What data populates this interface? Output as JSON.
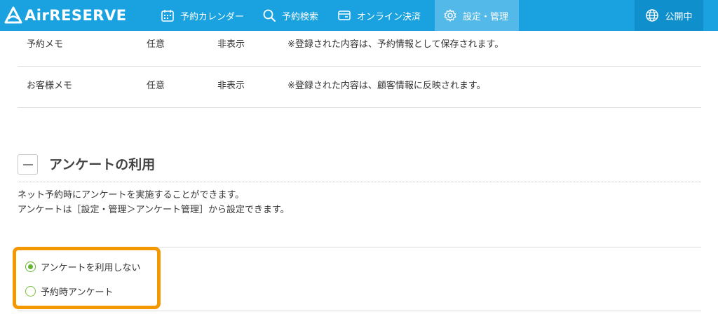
{
  "header": {
    "logo_text": "AirRESERVE",
    "nav": [
      {
        "label": "予約カレンダー",
        "icon": "calendar-icon"
      },
      {
        "label": "予約検索",
        "icon": "search-icon"
      },
      {
        "label": "オンライン決済",
        "icon": "card-icon"
      },
      {
        "label": "設定・管理",
        "icon": "gear-icon",
        "active": true
      }
    ],
    "publish_label": "公開中",
    "colors": {
      "bar": "#1aa2e0",
      "active": "#53b9e8",
      "publish_bg": "#0f8fcc"
    }
  },
  "memo_rows": [
    {
      "name": "予約メモ",
      "required": "任意",
      "display": "非表示",
      "note": "※登録された内容は、予約情報として保存されます。"
    },
    {
      "name": "お客様メモ",
      "required": "任意",
      "display": "非表示",
      "note": "※登録された内容は、顧客情報に反映されます。"
    }
  ],
  "survey": {
    "title": "アンケートの利用",
    "description_line1": "ネット予約時にアンケートを実施することができます。",
    "description_line2": "アンケートは［設定・管理＞アンケート管理］から設定できます。",
    "options": [
      {
        "label": "アンケートを利用しない",
        "checked": true
      },
      {
        "label": "予約時アンケート",
        "checked": false
      }
    ],
    "highlight_color": "#f39800"
  }
}
